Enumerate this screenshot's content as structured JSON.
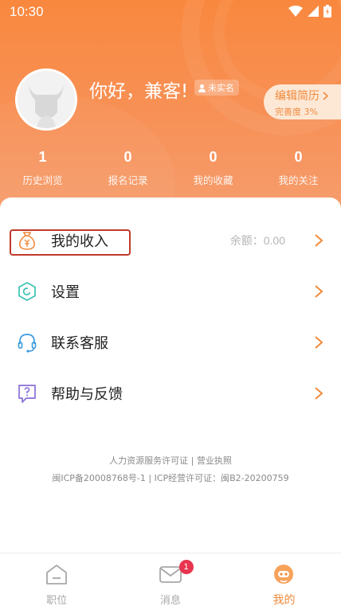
{
  "status_bar": {
    "time": "10:30"
  },
  "profile": {
    "greeting": "你好，兼客!",
    "verify_badge": "未实名",
    "resume_title": "编辑简历",
    "resume_completion": "完善度 3%"
  },
  "stats": [
    {
      "value": "1",
      "label": "历史浏览"
    },
    {
      "value": "0",
      "label": "报名记录"
    },
    {
      "value": "0",
      "label": "我的收藏"
    },
    {
      "value": "0",
      "label": "我的关注"
    }
  ],
  "menu": {
    "income_label": "我的收入",
    "income_balance": "余额：0.00",
    "settings_label": "设置",
    "support_label": "联系客服",
    "help_label": "帮助与反馈"
  },
  "footer": {
    "licenses": "人力资源服务许可证 | 营业执照",
    "icp": "闽ICP备20008768号-1 | ICP经营许可证：闽B2-20200759"
  },
  "tabbar": {
    "jobs": "职位",
    "messages": "消息",
    "messages_badge": "1",
    "mine": "我的"
  },
  "colors": {
    "accent": "#f08a3c",
    "header_top": "#f9883e",
    "badge": "#e8344f",
    "highlight": "#c0392b"
  }
}
